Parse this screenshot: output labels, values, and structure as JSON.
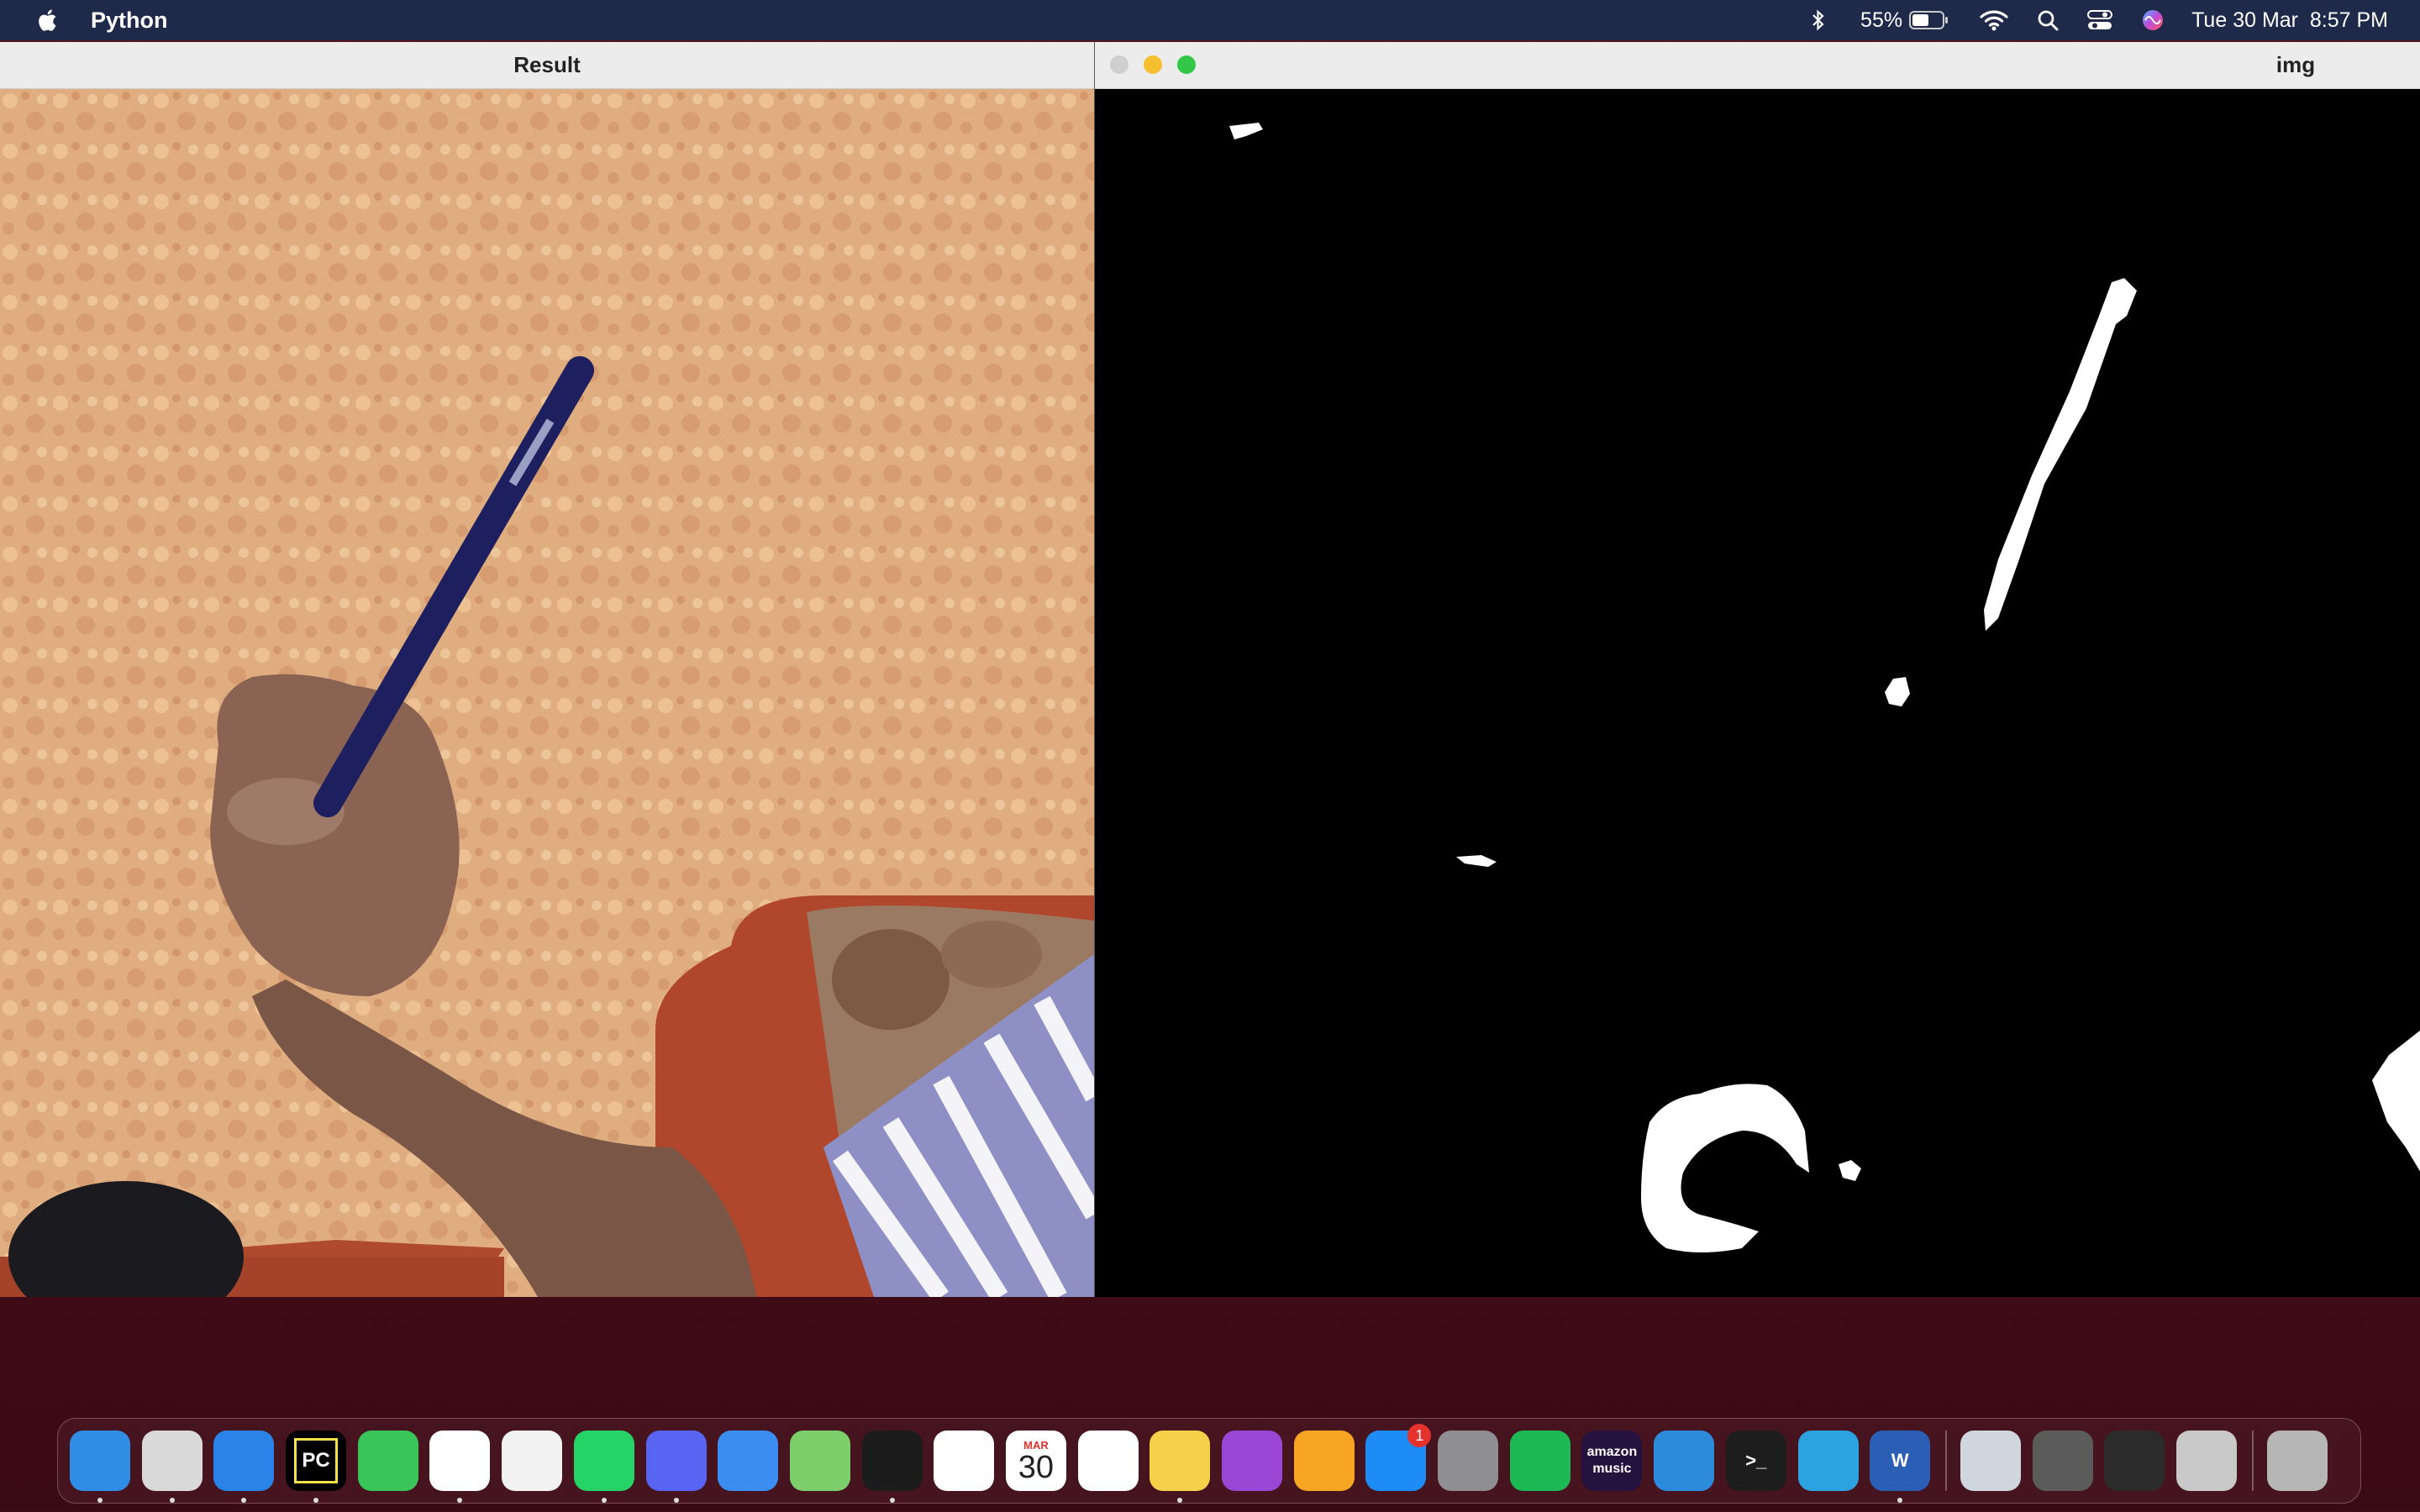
{
  "menubar": {
    "app_name": "Python",
    "battery_percent": "55%",
    "datetime": "Tue 30 Mar  8:57 PM"
  },
  "windows": {
    "result": {
      "title": "Result"
    },
    "img": {
      "title": "img"
    }
  },
  "dock": {
    "items": [
      {
        "name": "finder",
        "color": "#2f8de4",
        "running": true
      },
      {
        "name": "launchpad",
        "color": "#d9d9d9",
        "running": true
      },
      {
        "name": "safari",
        "color": "#2a84e8",
        "running": true
      },
      {
        "name": "pycharm",
        "label": "PC",
        "color": "#000000",
        "running": true
      },
      {
        "name": "messages",
        "color": "#3ac55a",
        "running": false
      },
      {
        "name": "chrome",
        "color": "#ffffff",
        "running": true
      },
      {
        "name": "xcode-instruments",
        "color": "#f2f2f2",
        "running": false
      },
      {
        "name": "whatsapp",
        "color": "#25d366",
        "running": true
      },
      {
        "name": "discord",
        "color": "#5865f2",
        "running": true
      },
      {
        "name": "mail",
        "color": "#3b8ef0",
        "running": false
      },
      {
        "name": "maps",
        "color": "#7ccf6a",
        "running": false
      },
      {
        "name": "activity-monitor",
        "color": "#1c1c1c",
        "running": true
      },
      {
        "name": "photos",
        "color": "#ffffff",
        "running": false
      },
      {
        "name": "calendar",
        "month": "MAR",
        "day": "30",
        "color": "#ffffff",
        "running": false
      },
      {
        "name": "reminders",
        "color": "#ffffff",
        "running": false
      },
      {
        "name": "notes",
        "color": "#f7d04a",
        "running": true
      },
      {
        "name": "podcasts",
        "color": "#9b47d6",
        "running": false
      },
      {
        "name": "pages",
        "color": "#f6a623",
        "running": false
      },
      {
        "name": "app-store",
        "color": "#1e8cf5",
        "badge": "1",
        "running": false
      },
      {
        "name": "system-preferences",
        "color": "#8e8e93",
        "running": false
      },
      {
        "name": "spotify",
        "color": "#1db954",
        "running": false
      },
      {
        "name": "amazon-music",
        "label": "amazon music",
        "color": "#25123f",
        "running": false
      },
      {
        "name": "vscode",
        "color": "#2c8bdb",
        "running": false
      },
      {
        "name": "terminal",
        "label": ">_",
        "color": "#1d1d1d",
        "running": false
      },
      {
        "name": "telegram",
        "color": "#2ca3e0",
        "running": false
      },
      {
        "name": "word",
        "label": "W",
        "color": "#2b5eb5",
        "running": true
      },
      {
        "name": "preview",
        "color": "#cfd6de",
        "running": false
      },
      {
        "name": "calculator",
        "color": "#5b5b5b",
        "running": false
      },
      {
        "name": "quicktime",
        "color": "#2b2b2b",
        "running": false
      },
      {
        "name": "python-launcher",
        "color": "#c9c9c9",
        "running": false
      },
      {
        "name": "trash",
        "color": "#b6b6b6",
        "running": false
      }
    ]
  }
}
